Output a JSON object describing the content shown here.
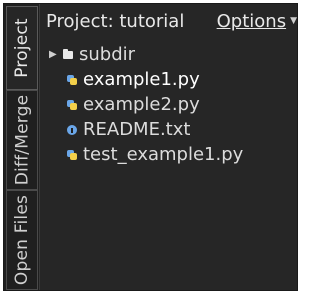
{
  "tabs": [
    {
      "id": "project",
      "label": "Project",
      "active": true
    },
    {
      "id": "diff",
      "label": "Diff/Merge",
      "active": false
    },
    {
      "id": "files",
      "label": "Open Files",
      "active": false
    }
  ],
  "header": {
    "title": "Project: tutorial",
    "options_label": "Options"
  },
  "tree": [
    {
      "type": "folder",
      "name": "subdir",
      "icon": "folder-icon",
      "expanded": false
    },
    {
      "type": "file",
      "name": "example1.py",
      "icon": "python-file-icon",
      "selected": true
    },
    {
      "type": "file",
      "name": "example2.py",
      "icon": "python-file-icon"
    },
    {
      "type": "file",
      "name": "README.txt",
      "icon": "info-icon"
    },
    {
      "type": "file",
      "name": "test_example1.py",
      "icon": "python-file-icon"
    }
  ],
  "colors": {
    "panel_bg": "#262626",
    "text": "#dcdcdc",
    "python_blue": "#6aa6e8",
    "python_yellow": "#f2cf4a"
  }
}
